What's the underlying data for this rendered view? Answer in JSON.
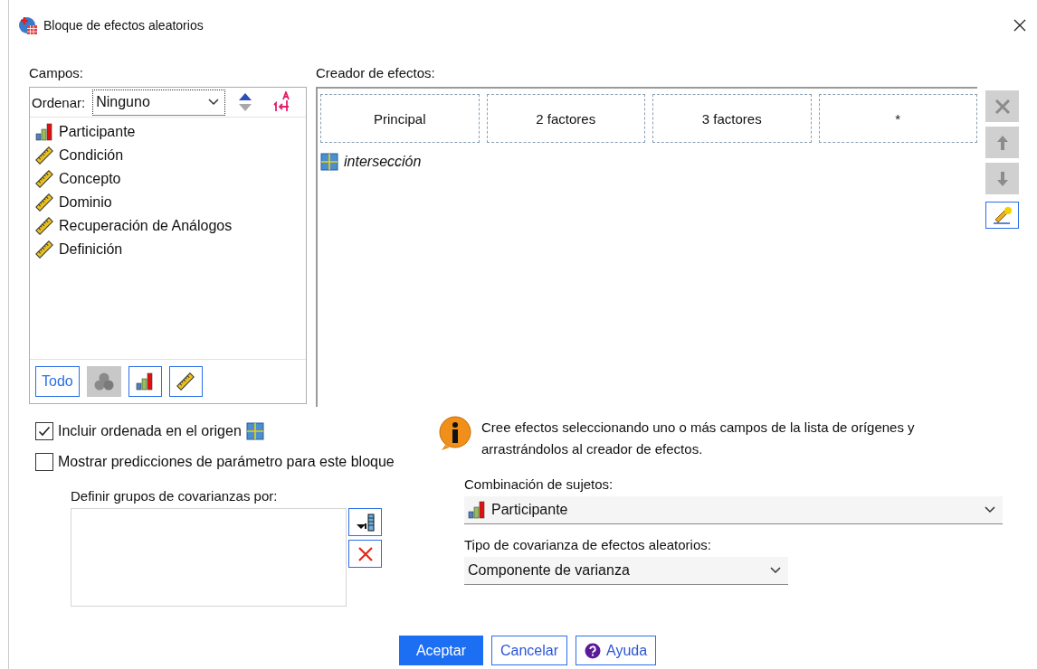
{
  "window": {
    "title": "Bloque de efectos aleatorios"
  },
  "fields": {
    "label": "Campos:",
    "sort_label": "Ordenar:",
    "sort_value": "Ninguno",
    "items": [
      {
        "name": "Participante",
        "kind": "nominal"
      },
      {
        "name": "Condición",
        "kind": "scale"
      },
      {
        "name": "Concepto",
        "kind": "scale"
      },
      {
        "name": "Dominio",
        "kind": "scale"
      },
      {
        "name": "Recuperación de Análogos",
        "kind": "scale"
      },
      {
        "name": "Definición",
        "kind": "scale"
      }
    ],
    "filters": [
      {
        "kind": "text",
        "label": "Todo",
        "disabled": false
      },
      {
        "kind": "set",
        "disabled": true
      },
      {
        "kind": "nominal",
        "disabled": false
      },
      {
        "kind": "scale",
        "disabled": false
      }
    ]
  },
  "effect_builder": {
    "label": "Creador de efectos:",
    "drop_zones": [
      "Principal",
      "2 factores",
      "3 factores",
      "*"
    ],
    "effects": [
      {
        "name": "intersección",
        "kind": "intercept"
      }
    ],
    "tools": [
      {
        "kind": "delete",
        "disabled": true
      },
      {
        "kind": "up",
        "disabled": true
      },
      {
        "kind": "down",
        "disabled": true
      },
      {
        "kind": "edit",
        "disabled": false
      }
    ]
  },
  "options": [
    {
      "label": "Incluir ordenada en el origen",
      "checked": true,
      "trailing_icon": true
    },
    {
      "label": "Mostrar predicciones de parámetro para este bloque",
      "checked": false,
      "trailing_icon": false
    }
  ],
  "covariance_groups": {
    "label": "Definir grupos de covarianzas por:"
  },
  "info": "Cree efectos seleccionando uno o más campos de la lista de orígenes y arrastrándolos al creador de efectos.",
  "subject": {
    "label": "Combinación de sujetos:",
    "value": "Participante",
    "kind": "nominal"
  },
  "covariance_type": {
    "label": "Tipo de covarianza de efectos aleatorios:",
    "value": "Componente de varianza"
  },
  "buttons": [
    {
      "label": "Aceptar",
      "kind": "primary"
    },
    {
      "label": "Cancelar",
      "kind": "plain"
    },
    {
      "label": "Ayuda",
      "kind": "help"
    }
  ]
}
